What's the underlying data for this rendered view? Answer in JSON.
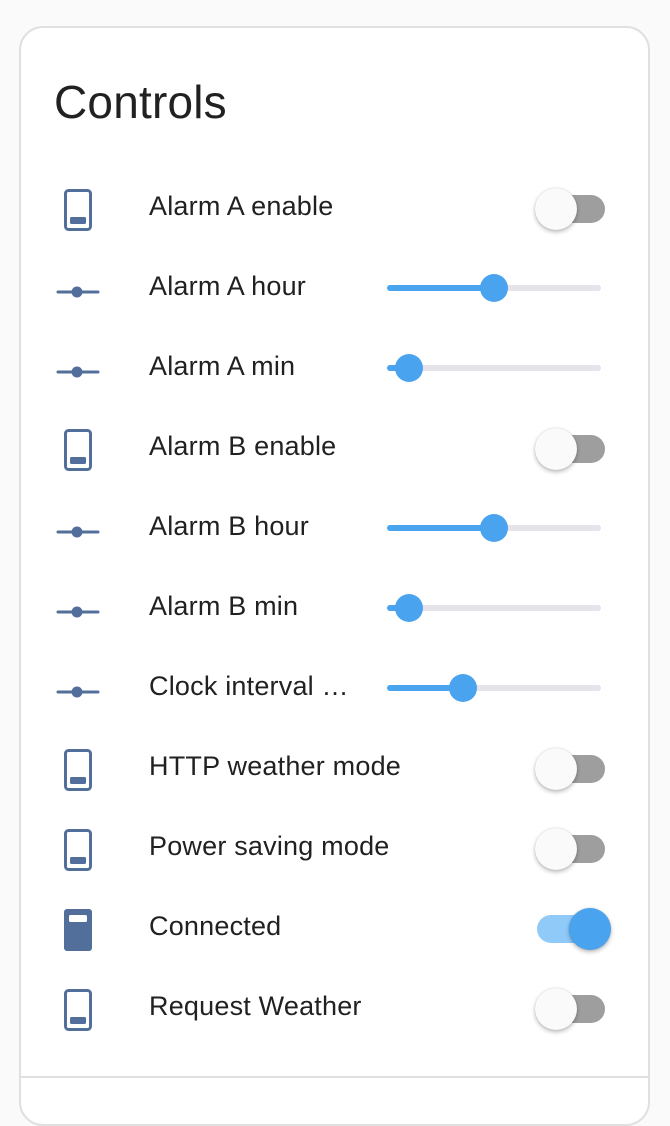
{
  "card": {
    "title": "Controls"
  },
  "colors": {
    "accent": "#4aa3ef",
    "icon": "#516f9a",
    "switch_off_track": "#9e9e9e",
    "switch_on_track": "#90caf9"
  },
  "rows": [
    {
      "label": "Alarm A enable",
      "icon": "phone-outline-icon",
      "control": "switch",
      "on": false
    },
    {
      "label": "Alarm A hour",
      "icon": "slider-icon",
      "control": "slider",
      "level": 0.52
    },
    {
      "label": "Alarm A min",
      "icon": "slider-icon",
      "control": "slider",
      "level": 0.0
    },
    {
      "label": "Alarm B enable",
      "icon": "phone-outline-icon",
      "control": "switch",
      "on": false
    },
    {
      "label": "Alarm B hour",
      "icon": "slider-icon",
      "control": "slider",
      "level": 0.52
    },
    {
      "label": "Alarm B min",
      "icon": "slider-icon",
      "control": "slider",
      "level": 0.0
    },
    {
      "label": "Clock interval …",
      "icon": "slider-icon",
      "control": "slider",
      "level": 0.33
    },
    {
      "label": "HTTP weather mode",
      "icon": "phone-outline-icon",
      "control": "switch",
      "on": false
    },
    {
      "label": "Power saving mode",
      "icon": "phone-outline-icon",
      "control": "switch",
      "on": false
    },
    {
      "label": "Connected",
      "icon": "phone-filled-icon",
      "control": "switch",
      "on": true
    },
    {
      "label": "Request Weather",
      "icon": "phone-outline-icon",
      "control": "switch",
      "on": false
    }
  ]
}
